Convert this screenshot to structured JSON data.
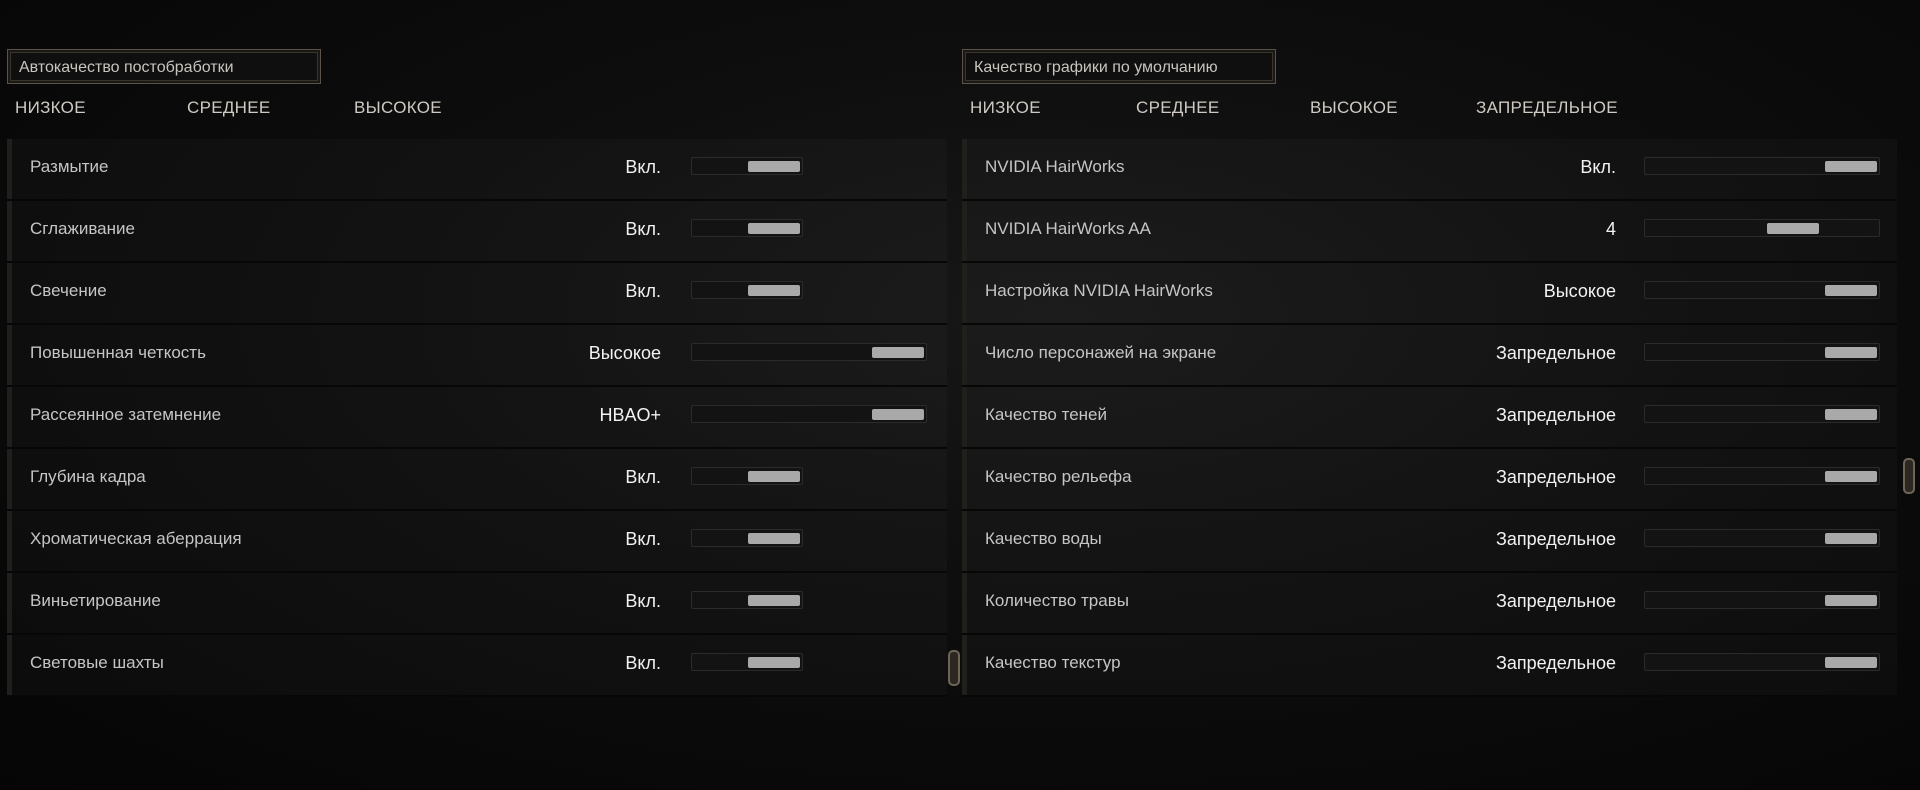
{
  "left": {
    "preset_title": "Автокачество постобработки",
    "levels": [
      "НИЗКОЕ",
      "СРЕДНЕЕ",
      "ВЫСОКОЕ"
    ],
    "rows": [
      {
        "label": "Размытие",
        "value": "Вкл.",
        "level": 1
      },
      {
        "label": "Сглаживание",
        "value": "Вкл.",
        "level": 1
      },
      {
        "label": "Свечение",
        "value": "Вкл.",
        "level": 1
      },
      {
        "label": "Повышенная четкость",
        "value": "Высокое",
        "level": 1
      },
      {
        "label": "Рассеянное затемнение",
        "value": "HBAO+",
        "level": 1
      },
      {
        "label": "Глубина кадра",
        "value": "Вкл.",
        "level": 1
      },
      {
        "label": "Хроматическая аберрация",
        "value": "Вкл.",
        "level": 1
      },
      {
        "label": "Виньетирование",
        "value": "Вкл.",
        "level": 1
      },
      {
        "label": "Световые шахты",
        "value": "Вкл.",
        "level": 1
      }
    ]
  },
  "right": {
    "preset_title": "Качество графики по умолчанию",
    "levels": [
      "НИЗКОЕ",
      "СРЕДНЕЕ",
      "ВЫСОКОЕ",
      "ЗАПРЕДЕЛЬНОЕ"
    ],
    "rows": [
      {
        "label": "NVIDIA HairWorks",
        "value": "Вкл.",
        "level": 1
      },
      {
        "label": "NVIDIA HairWorks AA",
        "value": "4",
        "level": 0.67
      },
      {
        "label": "Настройка NVIDIA HairWorks",
        "value": "Высокое",
        "level": 1
      },
      {
        "label": "Число персонажей на экране",
        "value": "Запредельное",
        "level": 1
      },
      {
        "label": "Качество теней",
        "value": "Запредельное",
        "level": 1
      },
      {
        "label": "Качество рельефа",
        "value": "Запредельное",
        "level": 1
      },
      {
        "label": "Качество воды",
        "value": "Запредельное",
        "level": 1
      },
      {
        "label": "Количество травы",
        "value": "Запредельное",
        "level": 1
      },
      {
        "label": "Качество текстур",
        "value": "Запредельное",
        "level": 1
      }
    ]
  },
  "colors": {
    "handle": "#a9a9a9",
    "value_text": "#f2f2f2",
    "label_text": "#c5c5c5",
    "frame": "#5a5148"
  }
}
